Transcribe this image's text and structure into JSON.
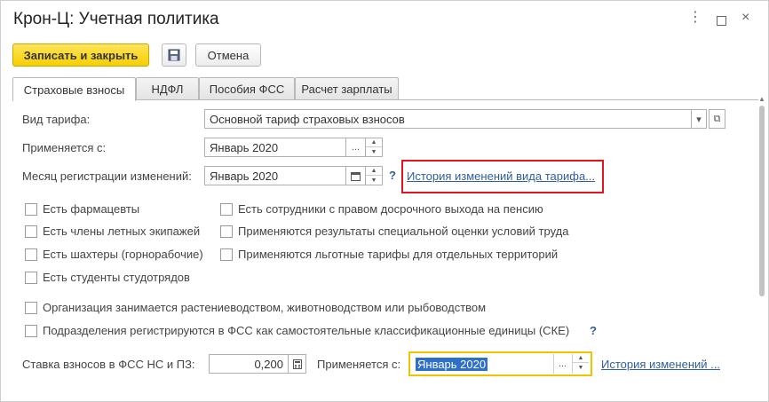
{
  "window": {
    "title": "Крон-Ц: Учетная политика",
    "controls": {
      "more": "⋮",
      "maximize": "",
      "close": "×"
    }
  },
  "toolbar": {
    "save_close_label": "Записать и закрыть",
    "save_icon": "floppy-disk-icon",
    "cancel_label": "Отмена"
  },
  "tabs": [
    {
      "label": "Страховые взносы",
      "active": true
    },
    {
      "label": "НДФЛ",
      "active": false
    },
    {
      "label": "Пособия ФСС",
      "active": false
    },
    {
      "label": "Расчет зарплаты",
      "active": false
    }
  ],
  "form": {
    "tariff_type": {
      "label": "Вид тарифа:",
      "value": "Основной тариф страховых взносов",
      "dropdown": "▾",
      "open": "⧉"
    },
    "applies_from": {
      "label": "Применяется с:",
      "value": "Январь 2020",
      "choose": "..."
    },
    "change_month": {
      "label": "Месяц регистрации изменений:",
      "value": "Январь 2020",
      "help": "?",
      "history_link": "История изменений вида тарифа..."
    },
    "checkboxes_left": [
      {
        "label": "Есть фармацевты",
        "checked": false
      },
      {
        "label": "Есть члены летных экипажей",
        "checked": false
      },
      {
        "label": "Есть шахтеры (горнорабочие)",
        "checked": false
      },
      {
        "label": "Есть студенты студотрядов",
        "checked": false
      }
    ],
    "checkboxes_right": [
      {
        "label": "Есть сотрудники с правом досрочного выхода на пенсию",
        "checked": false
      },
      {
        "label": "Применяются результаты специальной оценки условий труда",
        "checked": false
      },
      {
        "label": "Применяются льготные тарифы для отдельных территорий",
        "checked": false
      }
    ],
    "checkboxes_full": [
      {
        "label": "Организация занимается растениеводством, животноводством или рыбоводством",
        "checked": false
      },
      {
        "label": "Подразделения регистрируются в ФСС как самостоятельные классификационные единицы (СКЕ)",
        "checked": false
      }
    ],
    "cke_help": "?",
    "fss_rate": {
      "label": "Ставка взносов в ФСС НС и ПЗ:",
      "value": "0,200"
    },
    "fss_applies": {
      "label": "Применяется с:",
      "value": "Январь 2020",
      "choose": "...",
      "history_link": "История изменений ..."
    }
  },
  "colors": {
    "primary_button": "#f6cf00",
    "link": "#2f5f9e",
    "highlight_red": "#e2141e",
    "highlight_yellow": "#f2c200",
    "selection": "#2e6fc9"
  }
}
